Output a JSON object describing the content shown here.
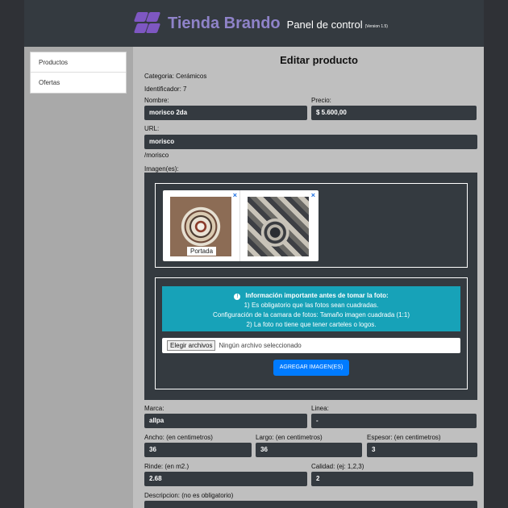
{
  "header": {
    "brand": "Tienda Brando",
    "subtitle": "Panel de control",
    "version": "(Version 1.5)"
  },
  "sidebar": {
    "items": [
      {
        "label": "Productos"
      },
      {
        "label": "Ofertas"
      }
    ]
  },
  "form": {
    "title": "Editar producto",
    "category_line": "Categoria: Cerámicos",
    "id_line": "Identificador: 7",
    "nombre_label": "Nombre:",
    "nombre_value": "morisco 2da",
    "precio_label": "Precio:",
    "precio_value": "$ 5.600,00",
    "url_label": "URL:",
    "url_value": "morisco",
    "url_path": "/morisco",
    "imagenes_label": "Imagen(es):",
    "portada_label": "Portada",
    "remove_icon": "×",
    "info_title": "Información importante antes de tomar la foto:",
    "info_line1": "1) Es obligatorio que las fotos sean cuadradas.",
    "info_line2": "Configuración de la camara de fotos: Tamaño imagen cuadrada (1:1)",
    "info_line3": "2) La foto no tiene que tener carteles o logos.",
    "file_button": "Elegir archivos",
    "file_none": "Ningún archivo seleccionado",
    "add_button": "AGREGAR IMAGEN(ES)",
    "marca_label": "Marca:",
    "marca_value": "allpa",
    "linea_label": "Linea:",
    "linea_value": "-",
    "ancho_label": "Ancho: (en centimetros)",
    "ancho_value": "36",
    "largo_label": "Largo: (en centimetros)",
    "largo_value": "36",
    "espesor_label": "Espesor: (en centimetros)",
    "espesor_value": "3",
    "rinde_label": "Rinde: (en m2.)",
    "rinde_value": "2.68",
    "calidad_label": "Calidad: (ej: 1,2,3)",
    "calidad_value": "2",
    "descripcion_label": "Descripcion: (no es obligatorio)"
  },
  "colors": {
    "accent": "#007bff",
    "info": "#17a2b8",
    "brand": "#7e57c2",
    "dark": "#343a40"
  }
}
